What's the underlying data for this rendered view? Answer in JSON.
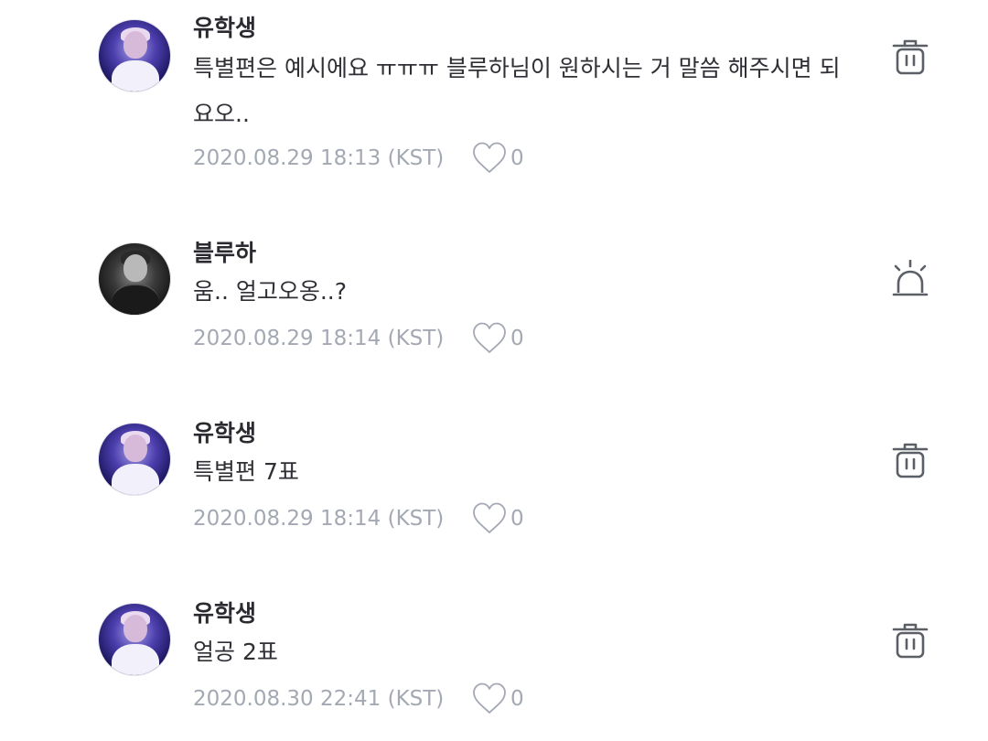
{
  "comments": [
    {
      "username": "유학생",
      "text": "특별편은 예시에요 ㅠㅠㅠ 블루하님이 원하시는 거 말씀 해주시면 되요오..",
      "timestamp": "2020.08.29 18:13 (KST)",
      "likes": "0",
      "avatar_icon": "avatar-purple-stage",
      "action_icon": "trash-icon"
    },
    {
      "username": "블루하",
      "text": "움.. 얼고오옹..?",
      "timestamp": "2020.08.29 18:14 (KST)",
      "likes": "0",
      "avatar_icon": "avatar-dark-portrait",
      "action_icon": "report-siren-icon"
    },
    {
      "username": "유학생",
      "text": "특별편 7표",
      "timestamp": "2020.08.29 18:14 (KST)",
      "likes": "0",
      "avatar_icon": "avatar-purple-stage",
      "action_icon": "trash-icon"
    },
    {
      "username": "유학생",
      "text": "얼공 2표",
      "timestamp": "2020.08.30 22:41 (KST)",
      "likes": "0",
      "avatar_icon": "avatar-purple-stage",
      "action_icon": "trash-icon"
    }
  ],
  "colors": {
    "text": "#2f2f35",
    "meta": "#a3a8b3",
    "icon": "#5b5f66"
  }
}
